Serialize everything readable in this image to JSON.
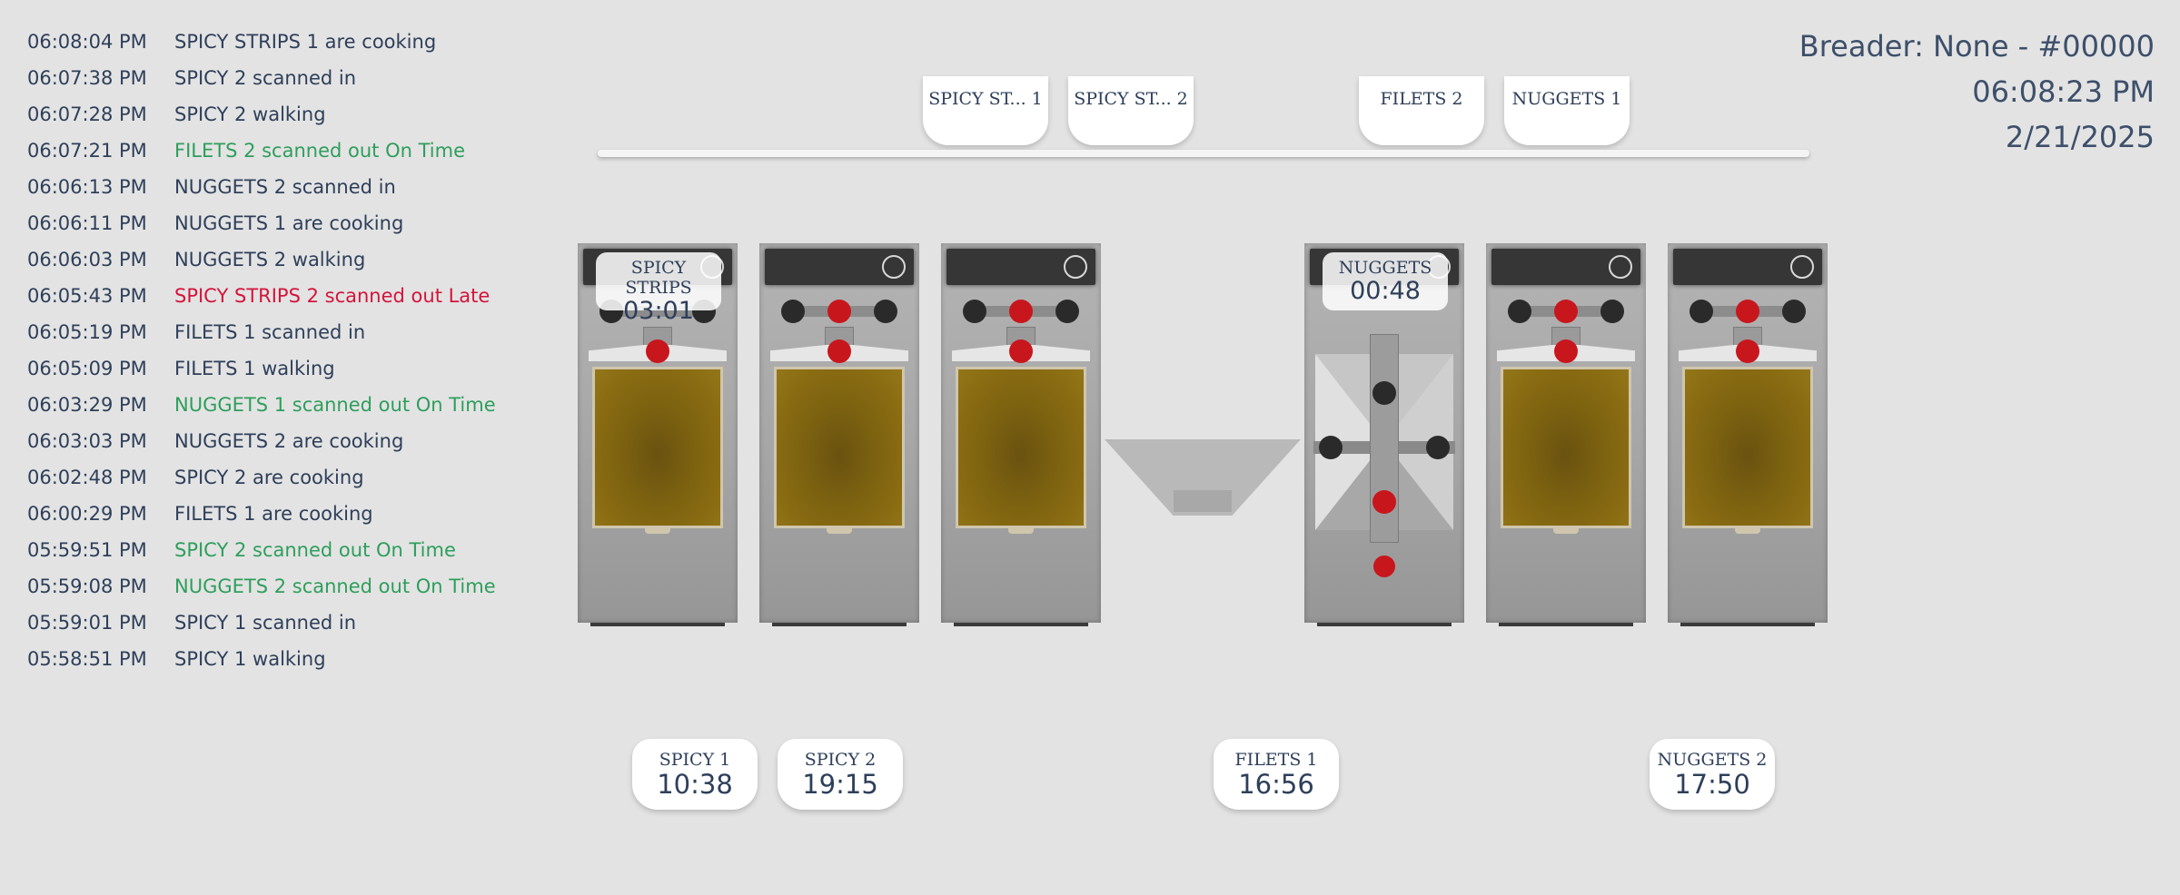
{
  "log": [
    {
      "time": "06:08:04 PM",
      "msg": "SPICY STRIPS 1 are cooking",
      "status": "normal"
    },
    {
      "time": "06:07:38 PM",
      "msg": "SPICY 2 scanned in",
      "status": "normal"
    },
    {
      "time": "06:07:28 PM",
      "msg": "SPICY 2 walking",
      "status": "normal"
    },
    {
      "time": "06:07:21 PM",
      "msg": "FILETS 2 scanned out On Time",
      "status": "ontime"
    },
    {
      "time": "06:06:13 PM",
      "msg": "NUGGETS 2 scanned in",
      "status": "normal"
    },
    {
      "time": "06:06:11 PM",
      "msg": "NUGGETS 1 are cooking",
      "status": "normal"
    },
    {
      "time": "06:06:03 PM",
      "msg": "NUGGETS 2 walking",
      "status": "normal"
    },
    {
      "time": "06:05:43 PM",
      "msg": "SPICY STRIPS 2 scanned out Late",
      "status": "late"
    },
    {
      "time": "06:05:19 PM",
      "msg": "FILETS 1 scanned in",
      "status": "normal"
    },
    {
      "time": "06:05:09 PM",
      "msg": "FILETS 1 walking",
      "status": "normal"
    },
    {
      "time": "06:03:29 PM",
      "msg": "NUGGETS 1 scanned out On Time",
      "status": "ontime"
    },
    {
      "time": "06:03:03 PM",
      "msg": "NUGGETS 2 are cooking",
      "status": "normal"
    },
    {
      "time": "06:02:48 PM",
      "msg": "SPICY 2 are cooking",
      "status": "normal"
    },
    {
      "time": "06:00:29 PM",
      "msg": "FILETS 1 are cooking",
      "status": "normal"
    },
    {
      "time": "05:59:51 PM",
      "msg": "SPICY 2 scanned out On Time",
      "status": "ontime"
    },
    {
      "time": "05:59:08 PM",
      "msg": "NUGGETS 2 scanned out On Time",
      "status": "ontime"
    },
    {
      "time": "05:59:01 PM",
      "msg": "SPICY 1 scanned in",
      "status": "normal"
    },
    {
      "time": "05:58:51 PM",
      "msg": "SPICY 1 walking",
      "status": "normal"
    }
  ],
  "header": {
    "breader": "Breader: None - #00000",
    "clock": "06:08:23 PM",
    "date": "2/21/2025"
  },
  "queue": {
    "q1": "SPICY ST... 1",
    "q2": "SPICY ST... 2",
    "q3": "FILETS 2",
    "q4": "NUGGETS 1"
  },
  "fryer_timers": {
    "f1": {
      "name": "SPICY STRIPS",
      "time": "03:01"
    },
    "f4": {
      "name": "NUGGETS",
      "time": "00:48"
    }
  },
  "holding": {
    "h1": {
      "name": "SPICY 1",
      "time": "10:38"
    },
    "h2": {
      "name": "SPICY 2",
      "time": "19:15"
    },
    "h3": {
      "name": "FILETS 1",
      "time": "16:56"
    },
    "h4": {
      "name": "NUGGETS 2",
      "time": "17:50"
    }
  },
  "colors": {
    "ontime": "#2e9e5c",
    "late": "#d3143b",
    "text": "#2e3f5a"
  }
}
